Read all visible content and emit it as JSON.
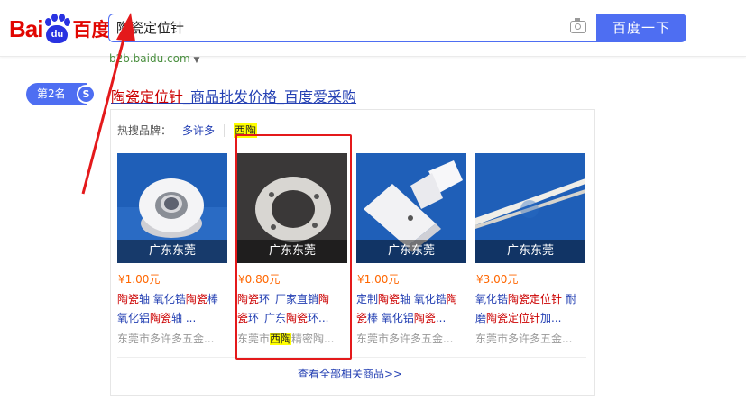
{
  "header": {
    "logo": {
      "bai": "Bai",
      "du": "du",
      "cn": "百度"
    },
    "search": {
      "value": "陶瓷定位针"
    },
    "search_button": "百度一下"
  },
  "result": {
    "url": "b2b.baidu.com",
    "rank": "第2名",
    "title_keyword": "陶瓷定位针",
    "title_rest": "_商品批发价格_百度爱采购",
    "brands_label": "热搜品牌：",
    "brands": [
      "多许多",
      "西陶"
    ],
    "products": [
      {
        "location": "广东东莞",
        "price": "¥1.00元",
        "desc_line1": [
          {
            "t": "陶瓷",
            "r": true
          },
          {
            "t": "轴 氧化锆",
            "r": false
          },
          {
            "t": "陶瓷",
            "r": true
          },
          {
            "t": "棒",
            "r": false
          }
        ],
        "desc_line2": [
          {
            "t": "氧化铝",
            "r": false
          },
          {
            "t": "陶瓷",
            "r": true
          },
          {
            "t": "轴 ...",
            "r": false
          }
        ],
        "shop": "东莞市多许多五金...",
        "shop_hl": ""
      },
      {
        "location": "广东东莞",
        "price": "¥0.80元",
        "desc_line1": [
          {
            "t": "陶瓷",
            "r": true
          },
          {
            "t": "环_厂家直销",
            "r": false
          },
          {
            "t": "陶",
            "r": true
          }
        ],
        "desc_line2": [
          {
            "t": "瓷",
            "r": true
          },
          {
            "t": "环_广东",
            "r": false
          },
          {
            "t": "陶瓷",
            "r": true
          },
          {
            "t": "环...",
            "r": false
          }
        ],
        "shop": "东莞市",
        "shop_hl": "西陶",
        "shop_tail": "精密陶..."
      },
      {
        "location": "广东东莞",
        "price": "¥1.00元",
        "desc_line1": [
          {
            "t": "定制",
            "r": false
          },
          {
            "t": "陶瓷",
            "r": true
          },
          {
            "t": "轴 氧化锆",
            "r": false
          },
          {
            "t": "陶",
            "r": true
          }
        ],
        "desc_line2": [
          {
            "t": "瓷",
            "r": true
          },
          {
            "t": "棒 氧化铝",
            "r": false
          },
          {
            "t": "陶瓷",
            "r": true
          },
          {
            "t": "...",
            "r": false
          }
        ],
        "shop": "东莞市多许多五金...",
        "shop_hl": ""
      },
      {
        "location": "广东东莞",
        "price": "¥3.00元",
        "desc_line1": [
          {
            "t": "氧化锆",
            "r": false
          },
          {
            "t": "陶瓷定位针",
            "r": true
          },
          {
            "t": " 耐",
            "r": false
          }
        ],
        "desc_line2": [
          {
            "t": "磨",
            "r": false
          },
          {
            "t": "陶瓷定位针",
            "r": true
          },
          {
            "t": "加...",
            "r": false
          }
        ],
        "shop": "东莞市多许多五金...",
        "shop_hl": ""
      }
    ],
    "more_link": "查看全部相关商品>>"
  },
  "colors": {
    "accent": "#4e6ef2",
    "link": "#2440b3",
    "highlight": "#cc0000",
    "price": "#ff6600",
    "annotation": "#e4191b"
  }
}
